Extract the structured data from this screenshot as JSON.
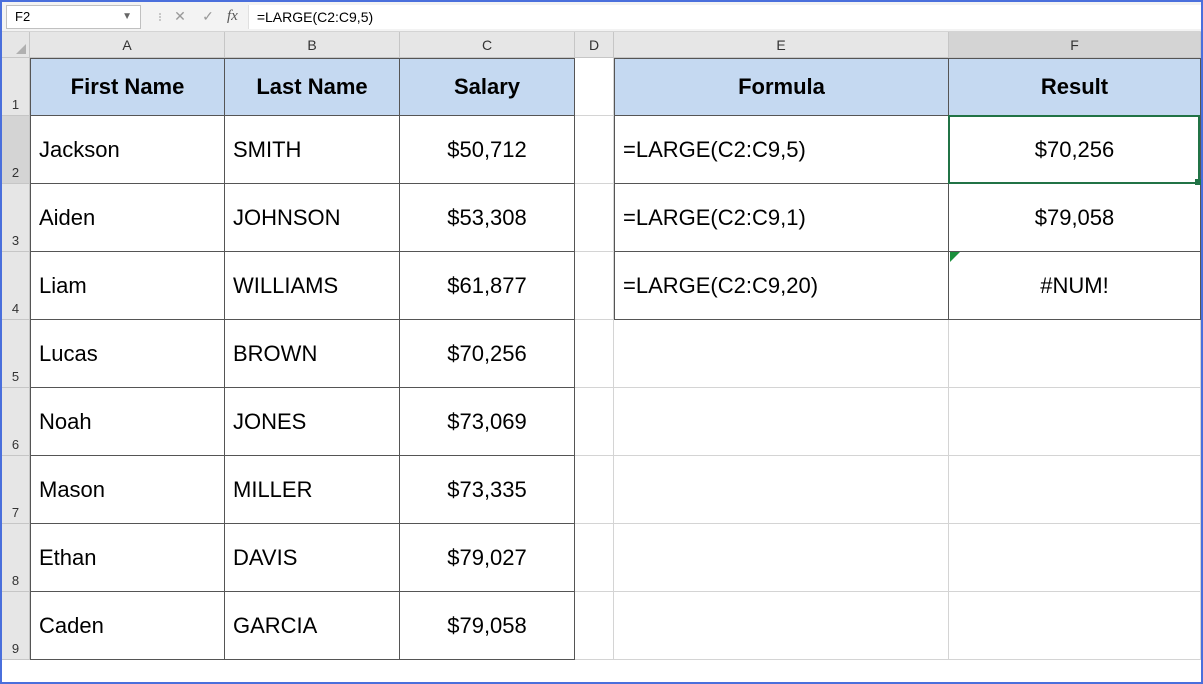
{
  "nameBox": "F2",
  "formulaBar": "=LARGE(C2:C9,5)",
  "columns": [
    "A",
    "B",
    "C",
    "D",
    "E",
    "F"
  ],
  "rows": [
    "1",
    "2",
    "3",
    "4",
    "5",
    "6",
    "7",
    "8",
    "9"
  ],
  "headers": {
    "A": "First Name",
    "B": "Last Name",
    "C": "Salary",
    "E": "Formula",
    "F": "Result"
  },
  "tableData": [
    {
      "first": "Jackson",
      "last": "SMITH",
      "salary": "$50,712"
    },
    {
      "first": "Aiden",
      "last": "JOHNSON",
      "salary": "$53,308"
    },
    {
      "first": "Liam",
      "last": "WILLIAMS",
      "salary": "$61,877"
    },
    {
      "first": "Lucas",
      "last": "BROWN",
      "salary": "$70,256"
    },
    {
      "first": "Noah",
      "last": "JONES",
      "salary": "$73,069"
    },
    {
      "first": "Mason",
      "last": "MILLER",
      "salary": "$73,335"
    },
    {
      "first": "Ethan",
      "last": "DAVIS",
      "salary": "$79,027"
    },
    {
      "first": "Caden",
      "last": "GARCIA",
      "salary": "$79,058"
    }
  ],
  "formulaTable": [
    {
      "formula": "=LARGE(C2:C9,5)",
      "result": "$70,256"
    },
    {
      "formula": "=LARGE(C2:C9,1)",
      "result": "$79,058"
    },
    {
      "formula": "=LARGE(C2:C9,20)",
      "result": "#NUM!"
    }
  ],
  "fxLabel": "fx",
  "activeCell": "F2"
}
